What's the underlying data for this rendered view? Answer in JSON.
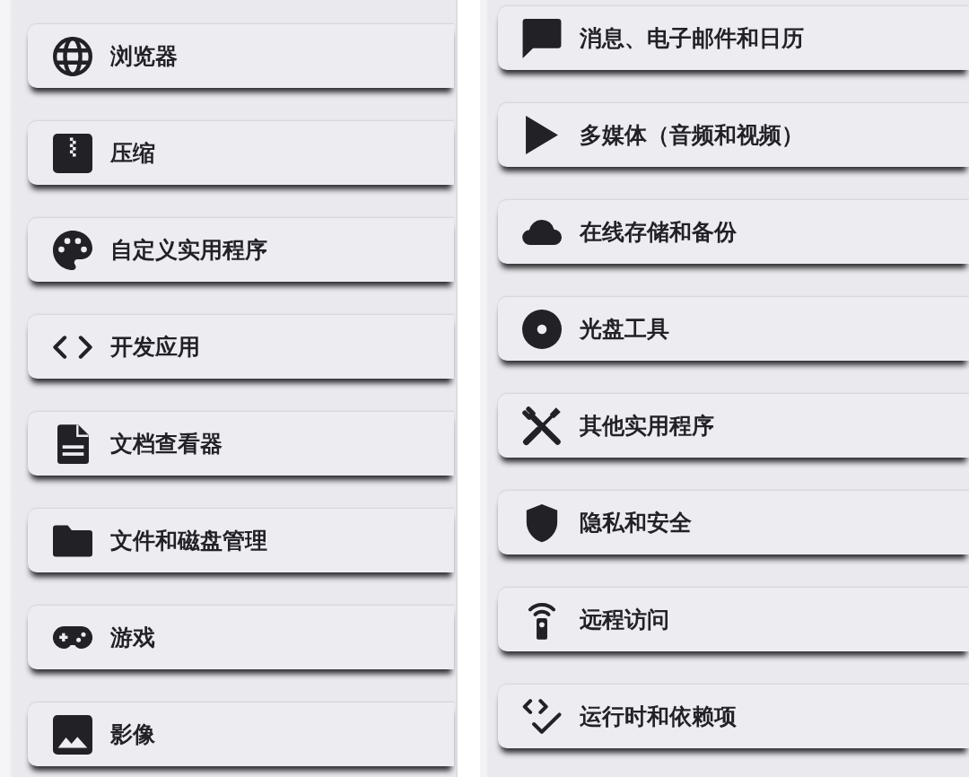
{
  "panels": [
    {
      "items": [
        {
          "kind": "globe",
          "label": "浏览器"
        },
        {
          "kind": "zip",
          "label": "压缩"
        },
        {
          "kind": "palette",
          "label": "自定义实用程序"
        },
        {
          "kind": "code",
          "label": "开发应用"
        },
        {
          "kind": "document",
          "label": "文档查看器"
        },
        {
          "kind": "folder",
          "label": "文件和磁盘管理"
        },
        {
          "kind": "gamepad",
          "label": "游戏"
        },
        {
          "kind": "image",
          "label": "影像"
        }
      ]
    },
    {
      "items": [
        {
          "kind": "chat",
          "label": "消息、电子邮件和日历"
        },
        {
          "kind": "play",
          "label": "多媒体（音频和视频）"
        },
        {
          "kind": "cloud",
          "label": "在线存储和备份"
        },
        {
          "kind": "disc",
          "label": "光盘工具"
        },
        {
          "kind": "tools",
          "label": "其他实用程序"
        },
        {
          "kind": "shield",
          "label": "隐私和安全"
        },
        {
          "kind": "remote",
          "label": "远程访问"
        },
        {
          "kind": "codecheck",
          "label": "运行时和依赖项"
        }
      ]
    }
  ]
}
